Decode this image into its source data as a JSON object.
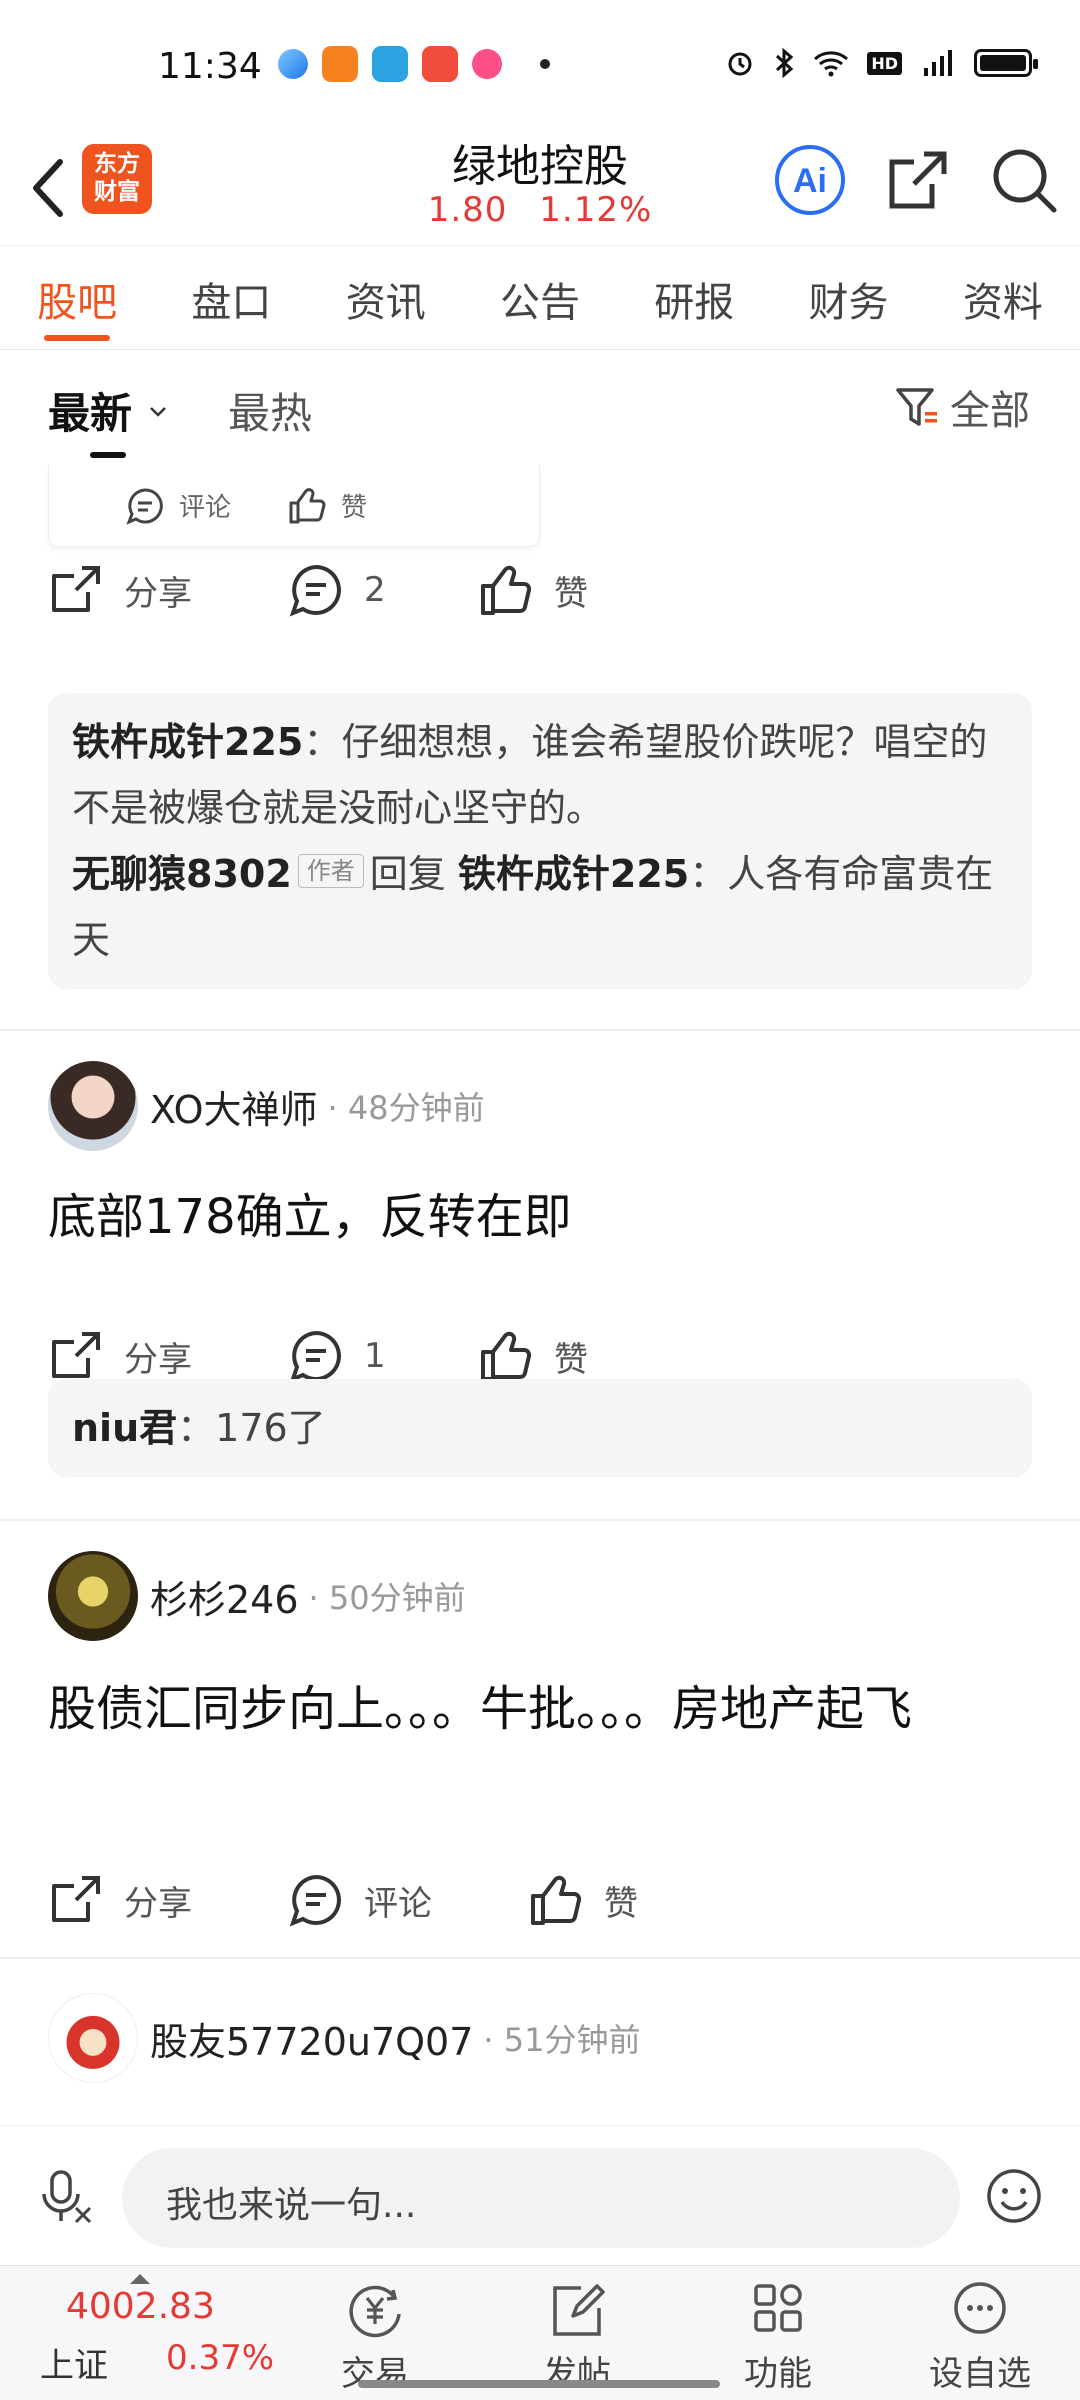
{
  "status_bar": {
    "time": "11:34"
  },
  "header": {
    "logo_text": "东方\n财富",
    "stock_name": "绿地控股",
    "price": "1.80",
    "change_pct": "1.12%",
    "ai_label": "Ai"
  },
  "tabs": [
    "股吧",
    "盘口",
    "资讯",
    "公告",
    "研报",
    "财务",
    "资料"
  ],
  "sort": {
    "latest": "最新",
    "hottest": "最热",
    "filter": "全部"
  },
  "card_tail": {
    "comment": "评论",
    "like": "赞"
  },
  "post0": {
    "share": "分享",
    "comments": "2",
    "like": "赞",
    "replies": [
      {
        "user": "铁杵成针225",
        "text": "：仔细想想，谁会希望股价跌呢？唱空的不是被爆仓就是没耐心坚守的。"
      },
      {
        "user": "无聊猿8302",
        "tag": "作者",
        "reply_word": "回复",
        "target": "铁杵成针225",
        "text": "：人各有命富贵在天"
      }
    ]
  },
  "post1": {
    "user": "XO大禅师",
    "time": "· 48分钟前",
    "body": "底部178确立，反转在即",
    "share": "分享",
    "comments": "1",
    "like": "赞",
    "reply": {
      "user": "niu君",
      "text": "：176了"
    }
  },
  "post2": {
    "user": "杉杉246",
    "time": "· 50分钟前",
    "body": "股债汇同步向上。。。牛批。。。房地产起飞",
    "share": "分享",
    "comments": "评论",
    "like": "赞"
  },
  "post3": {
    "user": "股友57720u7Q07",
    "time": "· 51分钟前"
  },
  "composer": {
    "placeholder": "我也来说一句..."
  },
  "bottom_nav": {
    "index_value": "4002.83",
    "index_name": "上证",
    "index_change": "0.37%",
    "items": [
      "交易",
      "发帖",
      "功能",
      "设自选"
    ]
  },
  "colors": {
    "accent": "#f0541e",
    "up": "#e53935",
    "ai_blue": "#2b6ef5"
  }
}
